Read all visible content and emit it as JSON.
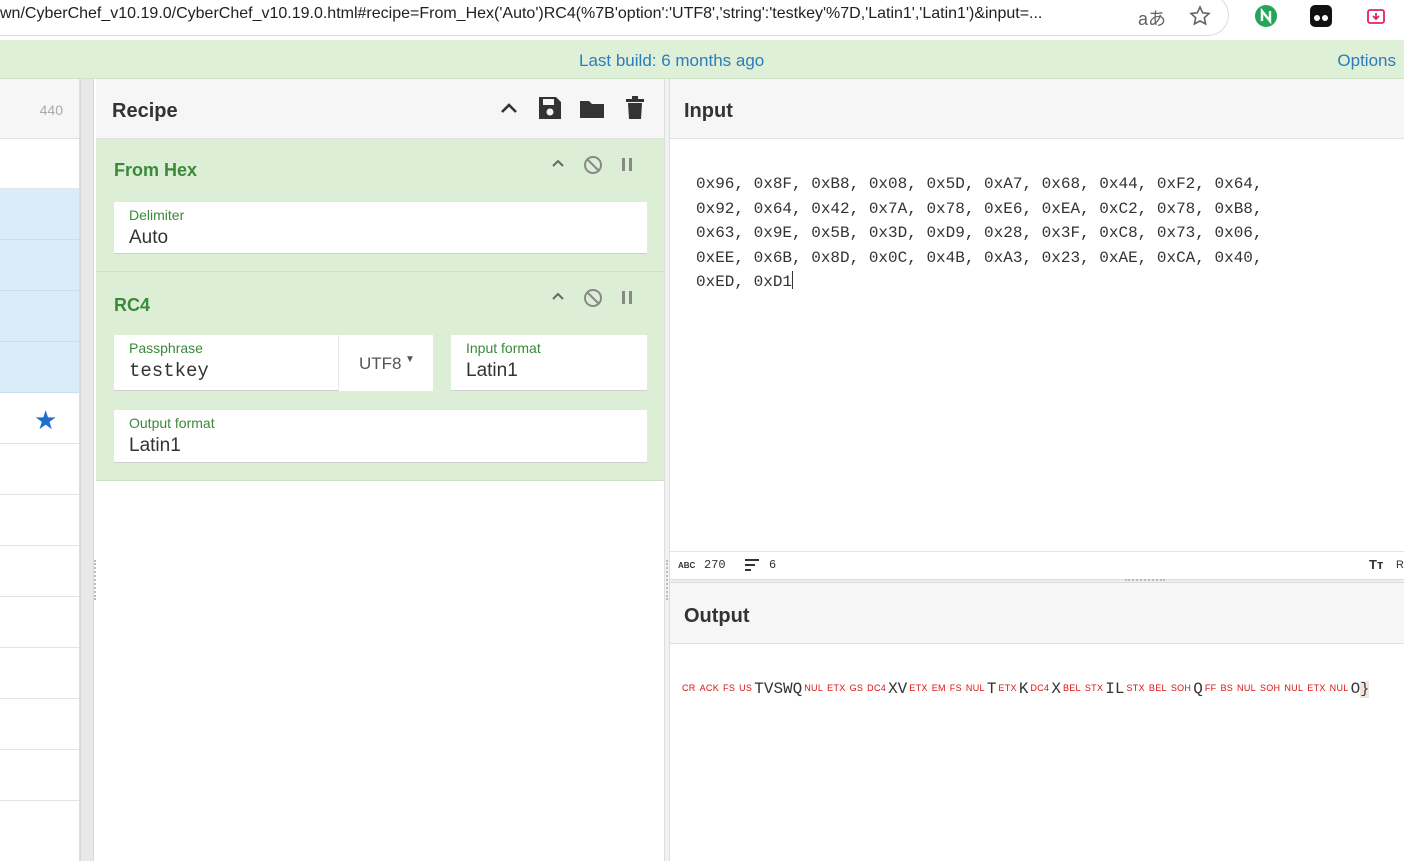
{
  "browser": {
    "url": "wn/CyberChef_v10.19.0/CyberChef_v10.19.0.html#recipe=From_Hex('Auto')RC4(%7B'option':'UTF8','string':'testkey'%7D,'Latin1','Latin1')&input=...",
    "icons": [
      "translate-icon",
      "star-icon",
      "extension-n-icon",
      "extension-mask-icon",
      "extension-download-icon"
    ],
    "translate_glyph": "aあ"
  },
  "banner": {
    "build_text": "Last build: 6 months ago",
    "options_label": "Options"
  },
  "operations": {
    "count_label": "440"
  },
  "recipe": {
    "title": "Recipe",
    "operations": [
      {
        "name": "From Hex",
        "fields": [
          {
            "label": "Delimiter",
            "value": "Auto"
          }
        ]
      },
      {
        "name": "RC4",
        "fields": [
          {
            "label": "Passphrase",
            "value": "testkey",
            "encoding": "UTF8"
          },
          {
            "label": "Input format",
            "value": "Latin1"
          },
          {
            "label": "Output format",
            "value": "Latin1"
          }
        ]
      }
    ]
  },
  "input": {
    "title": "Input",
    "lines": [
      "0x96, 0x8F, 0xB8, 0x08, 0x5D, 0xA7, 0x68, 0x44, 0xF2, 0x64,",
      "0x92, 0x64, 0x42, 0x7A, 0x78, 0xE6, 0xEA, 0xC2, 0x78, 0xB8,",
      "0x63, 0x9E, 0x5B, 0x3D, 0xD9, 0x28, 0x3F, 0xC8, 0x73, 0x06,",
      "0xEE, 0x6B, 0x8D, 0x0C, 0x4B, 0xA3, 0x23, 0xAE, 0xCA, 0x40,",
      "0xED, 0xD1"
    ],
    "status": {
      "length_icon": "ABC",
      "length": "270",
      "lines_count": "6",
      "font_icon": "Tт",
      "trailing": "R"
    }
  },
  "output": {
    "title": "Output",
    "segments": [
      {
        "t": "cc",
        "v": "CR"
      },
      {
        "t": "cc",
        "v": "ACK"
      },
      {
        "t": "cc",
        "v": "FS"
      },
      {
        "t": "cc",
        "v": "US"
      },
      {
        "t": "pt",
        "v": "TVSWQ"
      },
      {
        "t": "cc",
        "v": "NUL"
      },
      {
        "t": "cc",
        "v": "ETX"
      },
      {
        "t": "cc",
        "v": "GS"
      },
      {
        "t": "cc",
        "v": "DC4"
      },
      {
        "t": "pt",
        "v": "XV"
      },
      {
        "t": "cc",
        "v": "ETX"
      },
      {
        "t": "cc",
        "v": "EM"
      },
      {
        "t": "cc",
        "v": "FS"
      },
      {
        "t": "cc",
        "v": "NUL"
      },
      {
        "t": "pt",
        "v": "T"
      },
      {
        "t": "cc",
        "v": "ETX"
      },
      {
        "t": "pt",
        "v": "K"
      },
      {
        "t": "cc",
        "v": "DC4"
      },
      {
        "t": "pt",
        "v": "X"
      },
      {
        "t": "cc",
        "v": "BEL"
      },
      {
        "t": "cc",
        "v": "STX"
      },
      {
        "t": "pt",
        "v": "IL"
      },
      {
        "t": "cc",
        "v": "STX"
      },
      {
        "t": "cc",
        "v": "BEL"
      },
      {
        "t": "cc",
        "v": "SOH"
      },
      {
        "t": "pt",
        "v": "Q"
      },
      {
        "t": "cc",
        "v": "FF"
      },
      {
        "t": "cc",
        "v": "BS"
      },
      {
        "t": "cc",
        "v": "NUL"
      },
      {
        "t": "cc",
        "v": "SOH"
      },
      {
        "t": "cc",
        "v": "NUL"
      },
      {
        "t": "cc",
        "v": "ETX"
      },
      {
        "t": "cc",
        "v": "NUL"
      },
      {
        "t": "pt",
        "v": "O"
      },
      {
        "t": "hl",
        "v": "}"
      }
    ]
  },
  "colors": {
    "banner_bg": "#dff0d8",
    "link": "#2c7bbd",
    "op_bg": "#dcefd6",
    "op_title": "#3a8a3a",
    "selected_row": "#d9ecf7",
    "control_char": "#dd1111"
  }
}
